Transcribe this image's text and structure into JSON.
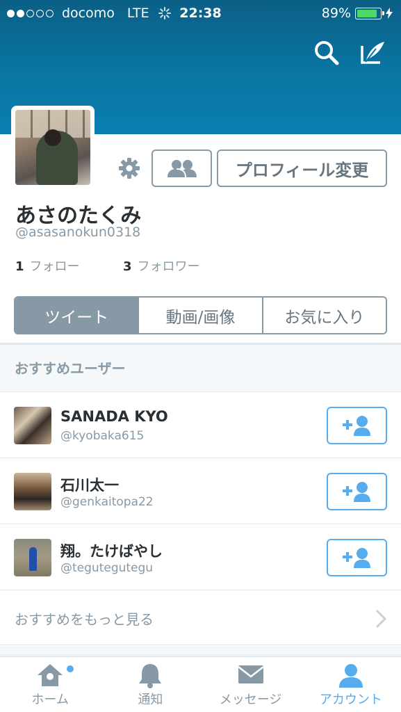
{
  "status_bar": {
    "carrier": "docomo",
    "network": "LTE",
    "time": "22:38",
    "battery": "89%",
    "battery_level": 0.89,
    "signal_dots_on": 2,
    "signal_dots_total": 5
  },
  "profile": {
    "display_name": "あさのたくみ",
    "screen_name": "@asasanokun0318",
    "edit_profile_label": "プロフィール変更",
    "following_count": "1",
    "following_label": "フォロー",
    "followers_count": "3",
    "followers_label": "フォロワー"
  },
  "tabs": [
    {
      "label": "ツイート",
      "active": true
    },
    {
      "label": "動画/画像",
      "active": false
    },
    {
      "label": "お気に入り",
      "active": false
    }
  ],
  "suggested": {
    "title": "おすすめユーザー",
    "users": [
      {
        "name": "SANADA KYO",
        "handle": "@kyobaka615"
      },
      {
        "name": "石川太一",
        "handle": "@genkaitopa22"
      },
      {
        "name": "翔。たけばやし",
        "handle": "@tegutegutegu"
      }
    ],
    "see_more": "おすすめをもっと見る"
  },
  "tabbar": [
    {
      "label": "ホーム",
      "icon": "home-icon",
      "active": false
    },
    {
      "label": "通知",
      "icon": "bell-icon",
      "active": false
    },
    {
      "label": "メッセージ",
      "icon": "envelope-icon",
      "active": false
    },
    {
      "label": "アカウント",
      "icon": "person-icon",
      "active": true
    }
  ],
  "colors": {
    "header_blue": "#0a76a3",
    "accent": "#55acee",
    "muted": "#8899a6",
    "battery_green": "#4cd964"
  }
}
